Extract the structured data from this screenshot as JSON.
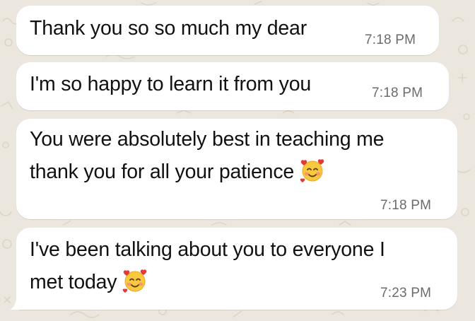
{
  "messages": [
    {
      "text": "Thank you so so much my dear",
      "time": "7:18 PM"
    },
    {
      "text": "I'm so happy to learn it from you",
      "time": "7:18 PM"
    },
    {
      "line1": "You were absolutely best in teaching me",
      "line2": "thank you for all your patience",
      "emoji": "smiling-face-with-hearts-icon",
      "time": "7:18 PM"
    },
    {
      "line1": "I've been talking about you to everyone I",
      "line2": "met today",
      "emoji": "smiling-face-with-hearts-icon",
      "time": "7:23 PM"
    }
  ],
  "colors": {
    "wallpaper": "#ece7de",
    "bubble": "#ffffff",
    "text": "#111111",
    "timestamp": "#6b6b6b"
  }
}
